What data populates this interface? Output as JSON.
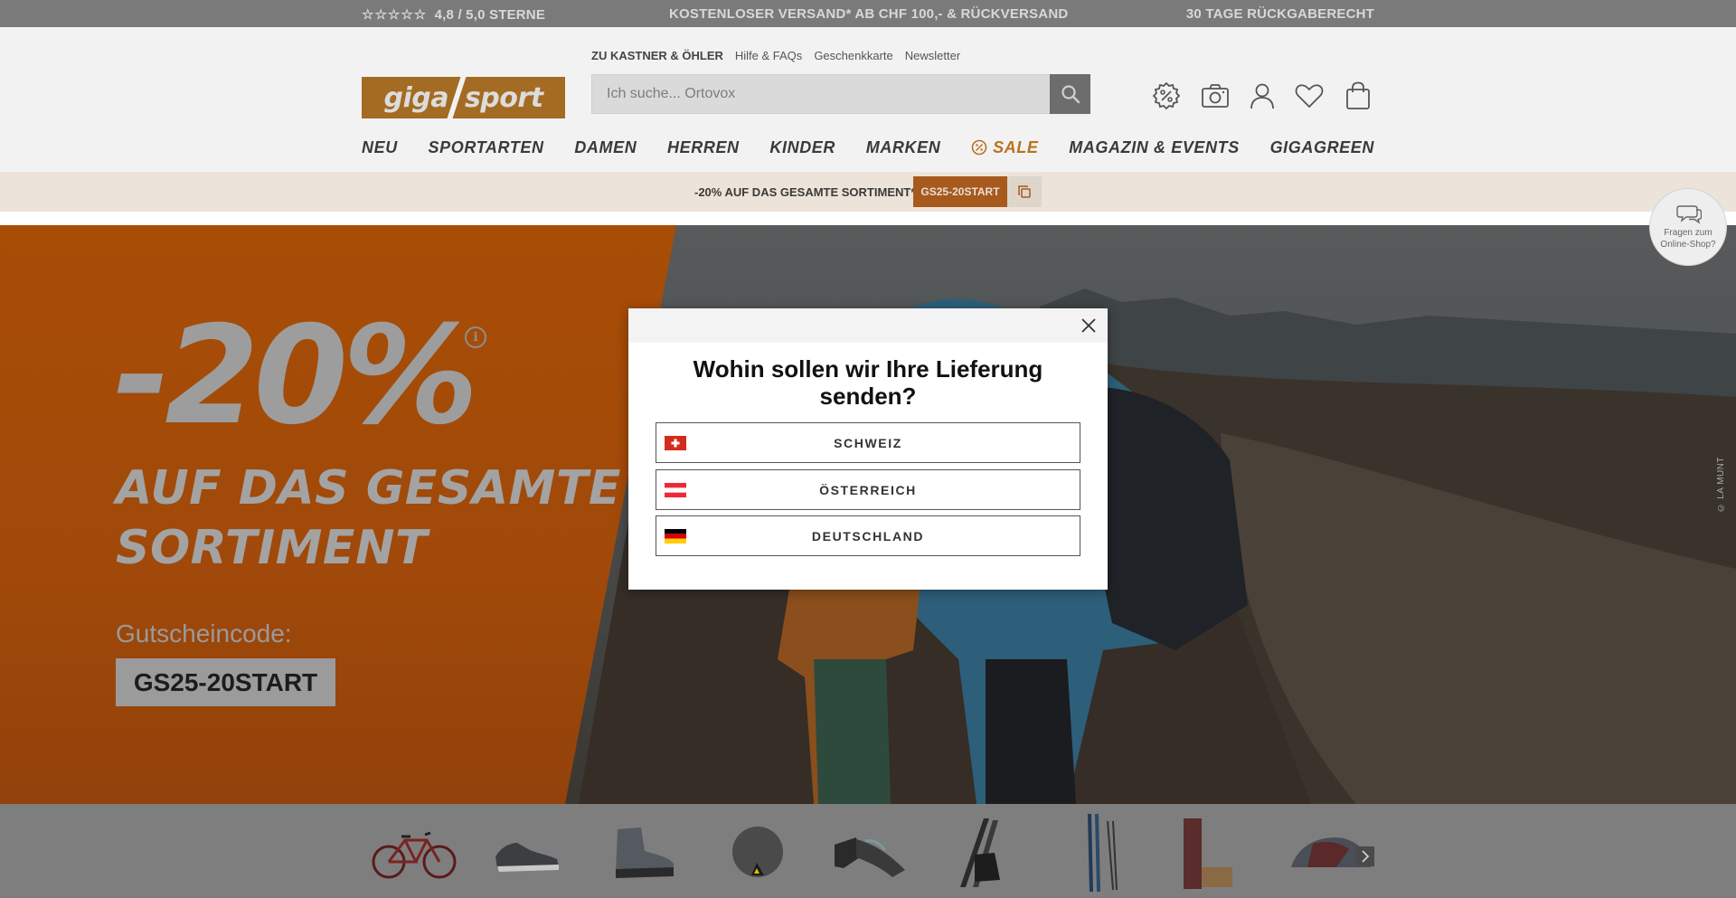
{
  "topbar": {
    "stars": "☆☆☆☆☆",
    "rating": "4,8 / 5,0 STERNE",
    "shipping": "KOSTENLOSER VERSAND* AB CHF 100,- & RÜCKVERSAND",
    "return": "30 TAGE RÜCKGABERECHT"
  },
  "header": {
    "service_links": [
      "ZU KASTNER & ÖHLER",
      "Hilfe & FAQs",
      "Geschenkkarte",
      "Newsletter"
    ],
    "logo_left": "giga",
    "logo_right": "sport",
    "search_placeholder": "Ich suche... Ortovox",
    "icons": [
      "discount-icon",
      "camera-icon",
      "account-icon",
      "wishlist-icon",
      "cart-icon"
    ]
  },
  "nav": [
    "NEU",
    "SPORTARTEN",
    "DAMEN",
    "HERREN",
    "KINDER",
    "MARKEN",
    "SALE",
    "MAGAZIN & EVENTS",
    "GIGAGREEN"
  ],
  "promo": {
    "text": "-20% AUF DAS GESAMTE SORTIMENT*",
    "code": "GS25-20START"
  },
  "chat": {
    "line1": "Fragen zum",
    "line2": "Online-Shop?"
  },
  "hero": {
    "percent": "-20%",
    "headline_line1": "AUF DAS GESAMTE",
    "headline_line2": "SORTIMENT",
    "voucher_label": "Gutscheincode:",
    "voucher_code": "GS25-20START",
    "copyright": "© LA MUNT"
  },
  "categories": [
    "bike",
    "running-shoe",
    "hiking-boot",
    "fitness-ball",
    "climbing-shoes",
    "ski-boots",
    "skis",
    "yoga-mat",
    "tent"
  ],
  "modal": {
    "title": "Wohin sollen wir Ihre Lieferung senden?",
    "countries": [
      {
        "label": "SCHWEIZ",
        "flag": "ch"
      },
      {
        "label": "ÖSTERREICH",
        "flag": "at"
      },
      {
        "label": "DEUTSCHLAND",
        "flag": "de"
      }
    ]
  },
  "colors": {
    "brand_orange": "#a46b22",
    "sale": "#b8721e",
    "promo_code_bg": "#a8591c",
    "hero_orange": "#a84d06"
  }
}
